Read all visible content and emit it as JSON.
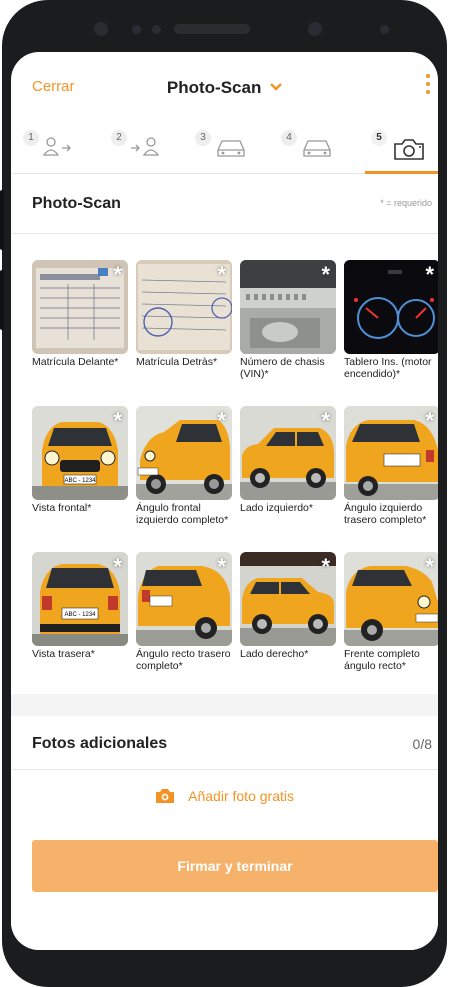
{
  "header": {
    "close_label": "Cerrar",
    "title": "Photo-Scan"
  },
  "steps": [
    {
      "num": "1",
      "icon": "person-arrow-icon"
    },
    {
      "num": "2",
      "icon": "arrow-person-icon"
    },
    {
      "num": "3",
      "icon": "car-icon"
    },
    {
      "num": "4",
      "icon": "car-icon"
    },
    {
      "num": "5",
      "icon": "camera-icon",
      "active": true
    }
  ],
  "section": {
    "title": "Photo-Scan",
    "required_note": "* = requerido"
  },
  "photos": [
    {
      "label": "Matrícula Delante*"
    },
    {
      "label": "Matrícula Detràs*"
    },
    {
      "label": "Número de chasis (VIN)*"
    },
    {
      "label": "Tablero Ins. (motor encendido)*"
    },
    {
      "label": "Vista frontal*"
    },
    {
      "label": "Ángulo frontal izquierdo completo*"
    },
    {
      "label": "Lado izquierdo*"
    },
    {
      "label": "Ángulo izquierdo trasero completo*"
    },
    {
      "label": "Vista trasera*"
    },
    {
      "label": "Ángulo recto trasero completo*"
    },
    {
      "label": "Lado derecho*"
    },
    {
      "label": "Frente completo ángulo recto*"
    }
  ],
  "plate_text": "ABC - 1234",
  "additional": {
    "title": "Fotos adicionales",
    "count": "0/8",
    "add_label": "Añadir foto gratis"
  },
  "footer": {
    "finish_label": "Firmar y terminar"
  },
  "colors": {
    "accent": "#f39325",
    "button": "#f6b26b",
    "car_body": "#f0a51e"
  }
}
